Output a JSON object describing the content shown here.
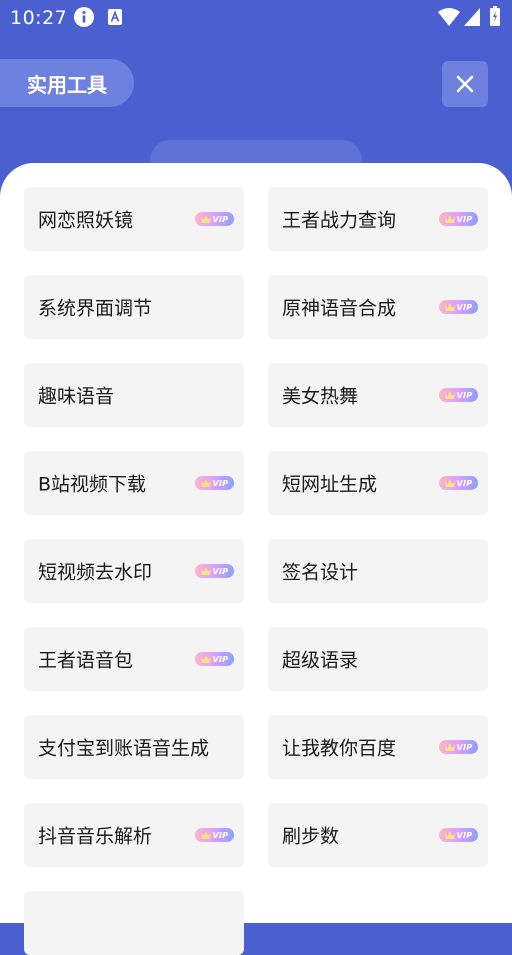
{
  "status_bar": {
    "time": "10:27",
    "icons": [
      "info-icon",
      "text-a-icon",
      "wifi-icon",
      "signal-icon",
      "battery-icon"
    ]
  },
  "header": {
    "title": "实用工具",
    "close_icon": "close-icon"
  },
  "colors": {
    "header_bg": "#4A5FD0",
    "pill_bg": "#6F81DE",
    "card_bg": "#F4F4F4",
    "vip_gradient": [
      "#FFB3C8",
      "#D9A0FF",
      "#8BA0FF"
    ]
  },
  "vip_text": "VIP",
  "tools": [
    {
      "label": "网恋照妖镜",
      "vip": true
    },
    {
      "label": "王者战力查询",
      "vip": true
    },
    {
      "label": "系统界面调节",
      "vip": false
    },
    {
      "label": "原神语音合成",
      "vip": true
    },
    {
      "label": "趣味语音",
      "vip": false
    },
    {
      "label": "美女热舞",
      "vip": true
    },
    {
      "label": "B站视频下载",
      "vip": true
    },
    {
      "label": "短网址生成",
      "vip": true
    },
    {
      "label": "短视频去水印",
      "vip": true
    },
    {
      "label": "签名设计",
      "vip": false
    },
    {
      "label": "王者语音包",
      "vip": true
    },
    {
      "label": "超级语录",
      "vip": false
    },
    {
      "label": "支付宝到账语音生成",
      "vip": false
    },
    {
      "label": "让我教你百度",
      "vip": true
    },
    {
      "label": "抖音音乐解析",
      "vip": true
    },
    {
      "label": "刷步数",
      "vip": true
    },
    {
      "label": "",
      "vip": false
    }
  ]
}
